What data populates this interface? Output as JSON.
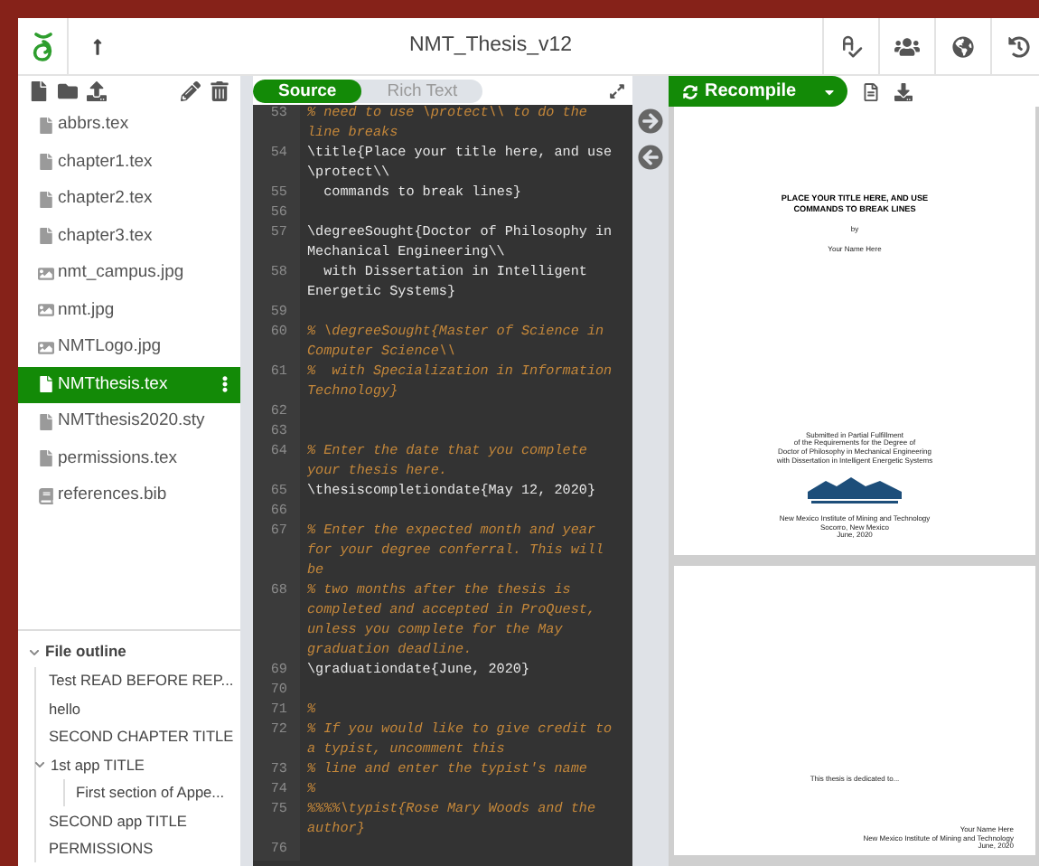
{
  "window": {
    "title": "NMT_Thesis_v12"
  },
  "file_tree": {
    "items": [
      {
        "name": "abbrs.tex",
        "kind": "file",
        "selected": false
      },
      {
        "name": "chapter1.tex",
        "kind": "file",
        "selected": false
      },
      {
        "name": "chapter2.tex",
        "kind": "file",
        "selected": false
      },
      {
        "name": "chapter3.tex",
        "kind": "file",
        "selected": false
      },
      {
        "name": "nmt_campus.jpg",
        "kind": "image",
        "selected": false
      },
      {
        "name": "nmt.jpg",
        "kind": "image",
        "selected": false
      },
      {
        "name": "NMTLogo.jpg",
        "kind": "image",
        "selected": false
      },
      {
        "name": "NMTthesis.tex",
        "kind": "file",
        "selected": true
      },
      {
        "name": "NMTthesis2020.sty",
        "kind": "file",
        "selected": false
      },
      {
        "name": "permissions.tex",
        "kind": "file",
        "selected": false
      },
      {
        "name": "references.bib",
        "kind": "bib",
        "selected": false
      }
    ]
  },
  "outline": {
    "title": "File outline",
    "expanded": true,
    "items": [
      {
        "label": "Test READ BEFORE REP..."
      },
      {
        "label": "hello"
      },
      {
        "label": "SECOND CHAPTER TITLE"
      },
      {
        "label": "1st app TITLE",
        "expanded": true,
        "children": [
          {
            "label": "First section of Appe..."
          }
        ]
      },
      {
        "label": "SECOND app TITLE"
      },
      {
        "label": "PERMISSIONS"
      }
    ]
  },
  "editor_tabs": [
    {
      "label": "Source",
      "selected": true
    },
    {
      "label": "Rich Text",
      "selected": false
    }
  ],
  "code": [
    {
      "n": "53",
      "kind": "comment",
      "text": "% need to use \\protect\\\\ to do the line breaks"
    },
    {
      "n": "54",
      "kind": "code",
      "text": "\\title{Place your title here, and use \\protect\\\\"
    },
    {
      "n": "55",
      "kind": "code",
      "text": "  commands to break lines}"
    },
    {
      "n": "56",
      "kind": "blank"
    },
    {
      "n": "57",
      "kind": "code",
      "text": "\\degreeSought{Doctor of Philosophy in Mechanical Engineering\\\\"
    },
    {
      "n": "58",
      "kind": "code",
      "text": "  with Dissertation in Intelligent   Energetic Systems}"
    },
    {
      "n": "59",
      "kind": "blank"
    },
    {
      "n": "60",
      "kind": "comment",
      "text": "% \\degreeSought{Master of Science in Computer Science\\\\"
    },
    {
      "n": "61",
      "kind": "comment",
      "text": "%  with Specialization in Information Technology}"
    },
    {
      "n": "62",
      "kind": "blank"
    },
    {
      "n": "63",
      "kind": "blank"
    },
    {
      "n": "64",
      "kind": "comment",
      "text": "% Enter the date that you complete your thesis here."
    },
    {
      "n": "65",
      "kind": "code",
      "text": "\\thesiscompletiondate{May 12, 2020}"
    },
    {
      "n": "66",
      "kind": "blank"
    },
    {
      "n": "67",
      "kind": "comment",
      "text": "% Enter the expected month and year for your degree conferral. This will be"
    },
    {
      "n": "68",
      "kind": "comment",
      "text": "% two months after the thesis is completed and accepted in ProQuest, unless you complete for the May graduation deadline."
    },
    {
      "n": "69",
      "kind": "code",
      "text": "\\graduationdate{June, 2020}"
    },
    {
      "n": "70",
      "kind": "blank"
    },
    {
      "n": "71",
      "kind": "comment",
      "text": "%"
    },
    {
      "n": "72",
      "kind": "comment",
      "text": "% If you would like to give credit to a typist, uncomment this"
    },
    {
      "n": "73",
      "kind": "comment",
      "text": "% line and enter the typist's name"
    },
    {
      "n": "74",
      "kind": "comment",
      "text": "%"
    },
    {
      "n": "75",
      "kind": "comment",
      "text": "%%%%\\typist{Rose Mary Woods and the author}"
    },
    {
      "n": "76",
      "kind": "blank"
    }
  ],
  "recompile": {
    "label": "Recompile"
  },
  "pdf_pages": [
    {
      "blocks": [
        {
          "kind": "title",
          "lines": [
            "PLACE YOUR TITLE HERE, AND USE",
            "COMMANDS TO BREAK LINES"
          ]
        },
        {
          "kind": "text",
          "lines": [
            "by"
          ]
        },
        {
          "kind": "text",
          "lines": [
            "Your Name Here"
          ]
        },
        {
          "kind": "gap"
        },
        {
          "kind": "text",
          "lines": [
            "Submitted in Partial Fulfillment",
            "of the Requirements for the Degree of",
            "Doctor of Philosophy in Mechanical Engineering",
            "with Dissertation in Intelligent Energetic Systems"
          ]
        },
        {
          "kind": "logo"
        },
        {
          "kind": "text",
          "lines": [
            "New Mexico Institute of Mining and Technology",
            "Socorro, New Mexico",
            "June, 2020"
          ]
        }
      ]
    },
    {
      "blocks": [
        {
          "kind": "gap"
        },
        {
          "kind": "text",
          "lines": [
            "This thesis is dedicated to..."
          ]
        },
        {
          "kind": "right",
          "lines": [
            "Your Name Here",
            "New Mexico Institute of Mining and Technology",
            "June, 2020"
          ]
        }
      ]
    }
  ]
}
